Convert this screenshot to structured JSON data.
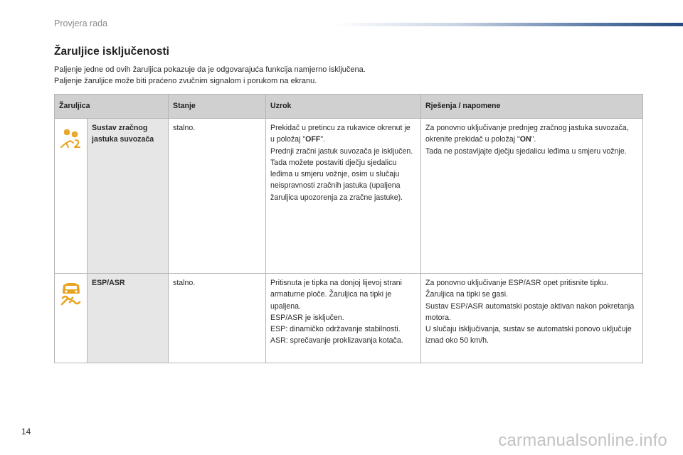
{
  "header": {
    "title": "Provjera rada"
  },
  "section": {
    "title": "Žaruljice isključenosti",
    "intro": [
      "Paljenje jedne od ovih žaruljica pokazuje da je odgovarajuća funkcija namjerno isključena.",
      "Paljenje žaruljice može biti praćeno zvučnim signalom i porukom na ekranu."
    ]
  },
  "table": {
    "columns": [
      "Žaruljica",
      "Stanje",
      "Uzrok",
      "Rješenja / napomene"
    ],
    "rows": [
      {
        "icon": "passenger-airbag-off-icon",
        "name": "Sustav zračnog jastuka suvozača",
        "state": "stalno.",
        "cause": {
          "before": "Prekidač u pretincu za rukavice okrenut je u položaj \"",
          "highlight": "OFF",
          "after": "\".",
          "lines": [
            "Prednji zračni jastuk suvozača je isključen.",
            "Tada možete postaviti dječju sjedalicu leđima u smjeru vožnje, osim u slučaju neispravnosti zračnih jastuka (upaljena žaruljica upozorenja za zračne jastuke)."
          ]
        },
        "solution": {
          "before": "Za ponovno uključivanje prednjeg zračnog jastuka suvozača, okrenite prekidač u položaj \"",
          "highlight": "ON",
          "after": "\".",
          "lines": [
            "Tada ne postavljajte dječju sjedalicu leđima u smjeru vožnje."
          ]
        }
      },
      {
        "icon": "esp-asr-off-icon",
        "name": "ESP/ASR",
        "state": "stalno.",
        "cause": [
          "Pritisnuta je tipka na donjoj lijevoj strani armaturne ploče. Žaruljica na tipki je upaljena.",
          "ESP/ASR je isključen.",
          "ESP: dinamičko održavanje stabilnosti.",
          "ASR: sprečavanje proklizavanja kotača."
        ],
        "solution": [
          "Za ponovno uključivanje ESP/ASR opet pritisnite tipku. Žaruljica na tipki se gasi.",
          "Sustav ESP/ASR automatski postaje aktivan nakon pokretanja motora.",
          "U slučaju isključivanja, sustav se automatski ponovo uključuje iznad oko 50 km/h."
        ]
      }
    ]
  },
  "footer": {
    "page_number": "14",
    "watermark": "carmanualsonline.info"
  },
  "colors": {
    "icon": "#e8a21e",
    "header_bar": "#274c80",
    "table_header": "#d0d0d0",
    "name_cell": "#e6e6e6"
  }
}
